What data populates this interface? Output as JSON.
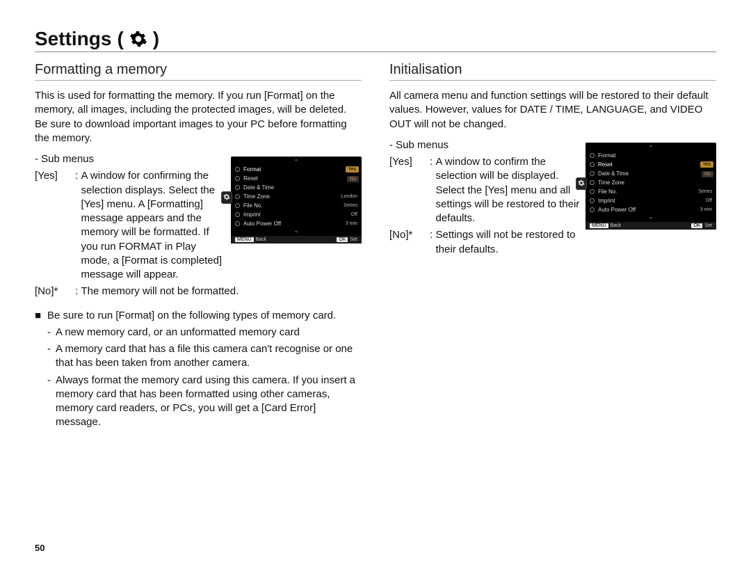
{
  "page_number": "50",
  "chapter_title": "Settings",
  "chapter_icon": "gear-icon",
  "left": {
    "title": "Formatting a memory",
    "intro": "This is used for formatting the memory. If you run [Format] on the memory, all images, including the protected images, will be deleted. Be sure to download important images to your PC before formatting the memory.",
    "sub_label": "- Sub menus",
    "defs": [
      {
        "key": "[Yes]",
        "sep": " : ",
        "val": "A window for confirming the selection displays. Select the [Yes] menu. A [Formatting] message appears and the memory will be formatted. If you run FORMAT in Play mode, a [Format is completed] message will appear."
      },
      {
        "key": "[No]*",
        "sep": " : ",
        "val": "The memory will not be formatted."
      }
    ],
    "bullet_lead": "Be sure to run [Format] on the following types of memory card.",
    "dashes": [
      "A new memory card, or an unformatted memory card",
      "A memory card that has a file this camera can't recognise or one that has been taken from another camera.",
      "Always format the memory card using this camera. If you insert a memory card that has been formatted using other cameras, memory card readers, or PCs, you will get a [Card Error] message."
    ],
    "shot": {
      "highlight_index": 0,
      "items": [
        {
          "label": "Format",
          "value": ""
        },
        {
          "label": "Reset",
          "value": ""
        },
        {
          "label": "Date & Time",
          "value": ""
        },
        {
          "label": "Time Zone",
          "value": "London"
        },
        {
          "label": "File No.",
          "value": "Series"
        },
        {
          "label": "Imprint",
          "value": "Off"
        },
        {
          "label": "Auto Power Off",
          "value": "3 min"
        }
      ],
      "yes": "Yes",
      "no": "No",
      "back": "Back",
      "set": "Set",
      "menu": "MENU",
      "ok": "OK"
    }
  },
  "right": {
    "title": "Initialisation",
    "intro": "All camera menu and function settings will be restored to their default values. However, values for DATE / TIME, LANGUAGE, and VIDEO OUT will not be changed.",
    "sub_label": "- Sub menus",
    "defs": [
      {
        "key": "[Yes]",
        "sep": " : ",
        "val": "A window to confirm the selection will be displayed. Select the [Yes] menu and all settings will be restored to their defaults."
      },
      {
        "key": "[No]*",
        "sep": " : ",
        "val": "Settings will not be restored to their defaults."
      }
    ],
    "shot": {
      "highlight_index": 1,
      "items": [
        {
          "label": "Format",
          "value": ""
        },
        {
          "label": "Reset",
          "value": ""
        },
        {
          "label": "Date & Time",
          "value": ""
        },
        {
          "label": "Time Zone",
          "value": ""
        },
        {
          "label": "File No.",
          "value": "Series"
        },
        {
          "label": "Imprint",
          "value": "Off"
        },
        {
          "label": "Auto Power Off",
          "value": "3 min"
        }
      ],
      "yes": "Yes",
      "no": "No",
      "back": "Back",
      "set": "Set",
      "menu": "MENU",
      "ok": "OK"
    }
  }
}
